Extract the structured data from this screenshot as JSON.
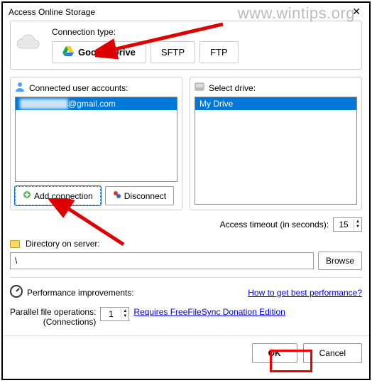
{
  "title": "Access Online Storage",
  "watermark": "www.wintips.org",
  "conn_type_label": "Connection type:",
  "tabs": {
    "gdrive": "Google Drive",
    "sftp": "SFTP",
    "ftp": "FTP"
  },
  "accounts_label": "Connected user accounts:",
  "account_item": "@gmail.com",
  "drive_label": "Select drive:",
  "drive_item": "My Drive",
  "btn_add": "Add connection",
  "btn_disconnect": "Disconnect",
  "timeout_label": "Access timeout (in seconds):",
  "timeout_value": "15",
  "dir_label": "Directory on server:",
  "dir_value": "\\",
  "browse": "Browse",
  "perf_label": "Performance improvements:",
  "perf_link": "How to get best performance?",
  "parallel_label1": "Parallel file operations:",
  "parallel_label2": "(Connections)",
  "parallel_value": "1",
  "donation_link": "Requires FreeFileSync Donation Edition",
  "ok": "OK",
  "cancel": "Cancel"
}
